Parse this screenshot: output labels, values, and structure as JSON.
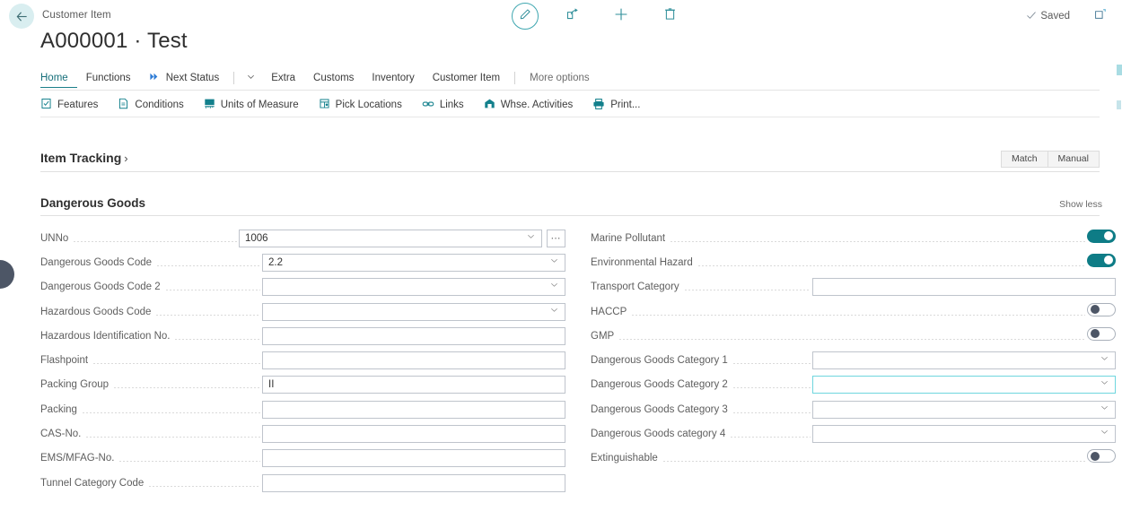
{
  "header": {
    "breadcrumb": "Customer Item",
    "title": "A000001 · Test",
    "back_icon": "back-arrow-icon",
    "actions": [
      {
        "name": "edit-button",
        "icon": "pencil-icon",
        "label": "Edit"
      },
      {
        "name": "share-button",
        "icon": "share-icon",
        "label": "Share"
      },
      {
        "name": "new-button",
        "icon": "plus-icon",
        "label": "New"
      },
      {
        "name": "delete-button",
        "icon": "trash-icon",
        "label": "Delete"
      }
    ],
    "saved_status": "Saved",
    "saved_icon": "checkmark-icon",
    "popout_icon": "open-in-new-window-icon"
  },
  "ribbon": {
    "tabs": [
      {
        "label": "Home",
        "active": true,
        "icon": null
      },
      {
        "label": "Functions",
        "active": false,
        "icon": null
      },
      {
        "label": "Next Status",
        "active": false,
        "icon": "fast-forward-icon"
      },
      {
        "label": "Extra",
        "active": false,
        "icon": null
      },
      {
        "label": "Customs",
        "active": false,
        "icon": null
      },
      {
        "label": "Inventory",
        "active": false,
        "icon": null
      },
      {
        "label": "Customer Item",
        "active": false,
        "icon": null
      }
    ],
    "more_options": "More options",
    "dropdown_icon": "chevron-down-icon"
  },
  "actionbar": {
    "items": [
      {
        "label": "Features",
        "icon": "features-icon"
      },
      {
        "label": "Conditions",
        "icon": "conditions-icon"
      },
      {
        "label": "Units of Measure",
        "icon": "units-of-measure-icon"
      },
      {
        "label": "Pick Locations",
        "icon": "pick-locations-icon"
      },
      {
        "label": "Links",
        "icon": "links-icon"
      },
      {
        "label": "Whse. Activities",
        "icon": "warehouse-activities-icon"
      },
      {
        "label": "Print...",
        "icon": "printer-icon"
      }
    ]
  },
  "item_tracking": {
    "title": "Item Tracking",
    "expand_icon": "chevron-right-icon",
    "pills": [
      {
        "label": "Match"
      },
      {
        "label": "Manual"
      }
    ]
  },
  "dangerous_goods": {
    "title": "Dangerous Goods",
    "show_less": "Show less",
    "left_fields": [
      {
        "label": "UNNo",
        "value": "1006",
        "type": "lookup",
        "focused": false
      },
      {
        "label": "Dangerous Goods Code",
        "value": "2.2",
        "type": "dropdown",
        "focused": false
      },
      {
        "label": "Dangerous Goods Code 2",
        "value": "",
        "type": "dropdown",
        "focused": false
      },
      {
        "label": "Hazardous Goods Code",
        "value": "",
        "type": "dropdown",
        "focused": false
      },
      {
        "label": "Hazardous Identification No.",
        "value": "",
        "type": "text",
        "focused": false
      },
      {
        "label": "Flashpoint",
        "value": "",
        "type": "text",
        "focused": false
      },
      {
        "label": "Packing Group",
        "value": "II",
        "type": "text",
        "focused": false
      },
      {
        "label": "Packing",
        "value": "",
        "type": "text",
        "focused": false
      },
      {
        "label": "CAS-No.",
        "value": "",
        "type": "text",
        "focused": false
      },
      {
        "label": "EMS/MFAG-No.",
        "value": "",
        "type": "text",
        "focused": false
      },
      {
        "label": "Tunnel Category Code",
        "value": "",
        "type": "text",
        "focused": false
      }
    ],
    "right_fields": [
      {
        "label": "Marine Pollutant",
        "value": "",
        "type": "toggle",
        "toggle_on": true,
        "focused": false
      },
      {
        "label": "Environmental Hazard",
        "value": "",
        "type": "toggle",
        "toggle_on": true,
        "focused": false
      },
      {
        "label": "Transport Category",
        "value": "",
        "type": "text",
        "focused": false
      },
      {
        "label": "HACCP",
        "value": "",
        "type": "toggle",
        "toggle_on": false,
        "focused": false
      },
      {
        "label": "GMP",
        "value": "",
        "type": "toggle",
        "toggle_on": false,
        "focused": false
      },
      {
        "label": "Dangerous Goods Category 1",
        "value": "",
        "type": "dropdown",
        "focused": false
      },
      {
        "label": "Dangerous Goods Category 2",
        "value": "",
        "type": "dropdown",
        "focused": true
      },
      {
        "label": "Dangerous Goods Category 3",
        "value": "",
        "type": "dropdown",
        "focused": false
      },
      {
        "label": "Dangerous Goods category 4",
        "value": "",
        "type": "dropdown",
        "focused": false
      },
      {
        "label": "Extinguishable",
        "value": "",
        "type": "toggle",
        "toggle_on": false,
        "focused": false
      }
    ]
  },
  "colors": {
    "accent_teal": "#0E7C86",
    "link_teal": "#166F7A",
    "focus_cyan": "#6FD6DE",
    "back_circle": "#D9EEF0",
    "next_status_blue": "#2E7CD6"
  }
}
